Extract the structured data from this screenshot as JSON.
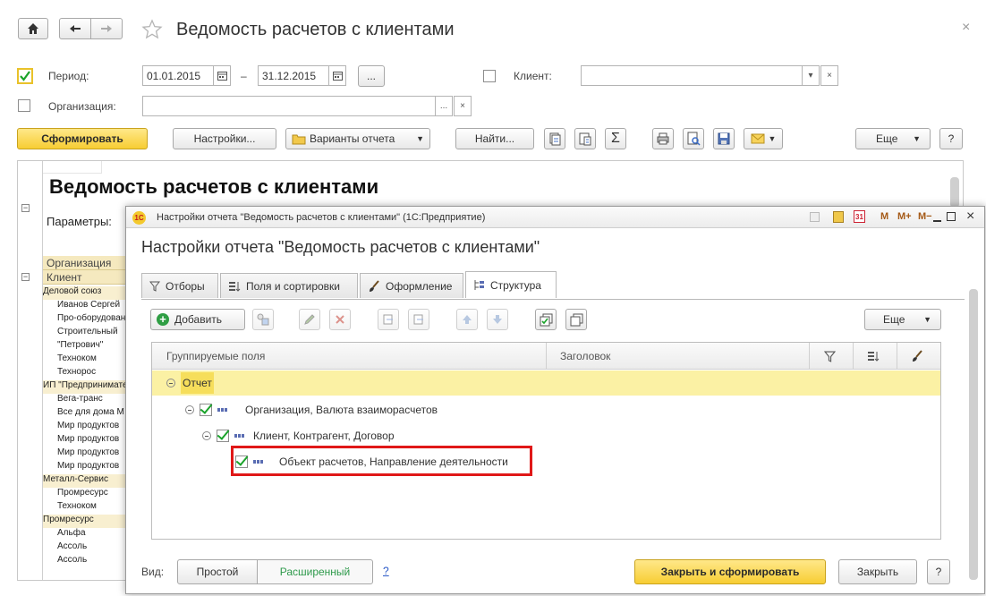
{
  "window": {
    "title": "Ведомость расчетов с клиентами",
    "close": "×"
  },
  "filters": {
    "period_label": "Период:",
    "date_from": "01.01.2015",
    "date_sep": "–",
    "date_to": "31.12.2015",
    "period_more": "...",
    "client_label": "Клиент:",
    "org_label": "Организация:",
    "more": "...",
    "clear": "×",
    "dropdown": "▾"
  },
  "toolbar": {
    "generate": "Сформировать",
    "settings": "Настройки...",
    "variants": "Варианты отчета",
    "find": "Найти...",
    "more": "Еще",
    "help": "?",
    "sigma": "Σ"
  },
  "report": {
    "title": "Ведомость расчетов с клиентами",
    "params_label": "Параметры:",
    "header_org": "Организация",
    "header_client": "Клиент",
    "rows": [
      {
        "text": "Деловой союз",
        "group": true
      },
      {
        "text": "Иванов Сергей",
        "group": false
      },
      {
        "text": "Про-оборудование",
        "group": false
      },
      {
        "text": "Строительный",
        "group": false
      },
      {
        "text": "\"Петрович\"",
        "group": false
      },
      {
        "text": "Техноком",
        "group": false
      },
      {
        "text": "Технорос",
        "group": false
      },
      {
        "text": "ИП \"Предприниматель\"",
        "group": true
      },
      {
        "text": "Вега-транс",
        "group": false
      },
      {
        "text": "Все для дома М",
        "group": false
      },
      {
        "text": "Мир продуктов",
        "group": false
      },
      {
        "text": "Мир продуктов",
        "group": false
      },
      {
        "text": "Мир продуктов",
        "group": false
      },
      {
        "text": "Мир продуктов",
        "group": false
      },
      {
        "text": "Металл-Сервис",
        "group": true
      },
      {
        "text": "Промресурс",
        "group": false
      },
      {
        "text": "Техноком",
        "group": false
      },
      {
        "text": "Промресурс",
        "group": true
      },
      {
        "text": "Альфа",
        "group": false
      },
      {
        "text": "Ассоль",
        "group": false
      },
      {
        "text": "Ассоль",
        "group": false
      }
    ]
  },
  "dialog": {
    "titlebar": "Настройки отчета \"Ведомость расчетов с клиентами\"  (1С:Предприятие)",
    "heading": "Настройки отчета \"Ведомость расчетов с клиентами\"",
    "titlebar_buttons": [
      "M",
      "M+",
      "M−"
    ],
    "tabs": [
      {
        "label": "Отборы",
        "icon": "filter-icon"
      },
      {
        "label": "Поля и сортировки",
        "icon": "sort-fields-icon"
      },
      {
        "label": "Оформление",
        "icon": "brush-icon"
      },
      {
        "label": "Структура",
        "icon": "structure-icon"
      }
    ],
    "add_button": "Добавить",
    "more_button": "Еще",
    "columns": {
      "fields": "Группируемые поля",
      "header": "Заголовок"
    },
    "tree": {
      "root": "Отчет",
      "level1": "Организация, Валюта взаиморасчетов",
      "level2": "Клиент, Контрагент, Договор",
      "level3": "Объект расчетов, Направление деятельности"
    },
    "view_label": "Вид:",
    "view_simple": "Простой",
    "view_extended": "Расширенный",
    "help_link": "?",
    "close_generate": "Закрыть и сформировать",
    "close": "Закрыть",
    "help": "?"
  },
  "colors": {
    "accent_yellow": "#f7cd33",
    "selection_row": "#fbf1a4",
    "highlight_frame": "#e01818",
    "check_green": "#1aa32a",
    "extended_green": "#2e9a4b"
  }
}
